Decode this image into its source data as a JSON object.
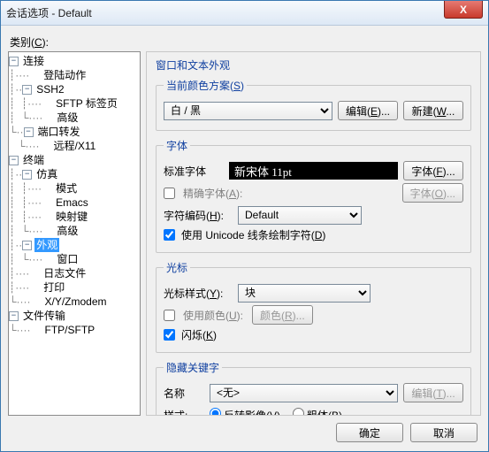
{
  "window": {
    "title": "会话选项 - Default",
    "close": "X"
  },
  "cat_label_pre": "类别(",
  "cat_label_u": "C",
  "cat_label_post": "):",
  "tree": {
    "n0": "连接",
    "n0_0": "登陆动作",
    "n0_1": "SSH2",
    "n0_1_0": "SFTP 标签页",
    "n0_1_1": "高级",
    "n0_2": "端口转发",
    "n0_2_0": "远程/X11",
    "n1": "终端",
    "n1_0": "仿真",
    "n1_0_0": "模式",
    "n1_0_1": "Emacs",
    "n1_0_2": "映射键",
    "n1_0_3": "高级",
    "n1_1": "外观",
    "n1_1_0": "窗口",
    "n1_2": "日志文件",
    "n1_3": "打印",
    "n1_4": "X/Y/Zmodem",
    "n2": "文件传输",
    "n2_0": "FTP/SFTP"
  },
  "pane_title": "窗口和文本外观",
  "scheme": {
    "legend_pre": "当前颜色方案(",
    "legend_u": "S",
    "legend_post": ")",
    "value": "白 / 黑",
    "edit_pre": "编辑(",
    "edit_u": "E",
    "edit_post": ")...",
    "new_pre": "新建(",
    "new_u": "W",
    "new_post": "..."
  },
  "fonts": {
    "legend": "字体",
    "std_label": "标准字体",
    "std_value": "新宋体  11pt",
    "std_btn_pre": "字体(",
    "std_btn_u": "F",
    "std_btn_post": ")...",
    "exact_pre": "精确字体(",
    "exact_u": "A",
    "exact_post": "):",
    "exact_btn_pre": "字体(",
    "exact_btn_u": "O",
    "exact_btn_post": ")...",
    "enc_pre": "字符编码(",
    "enc_u": "H",
    "enc_post": "):",
    "enc_value": "Default",
    "uni_pre": "使用 Unicode 线条绘制字符(",
    "uni_u": "D",
    "uni_post": ")"
  },
  "cursor": {
    "legend": "光标",
    "style_pre": "光标样式(",
    "style_u": "Y",
    "style_post": "):",
    "style_value": "块",
    "color_pre": "使用颜色(",
    "color_u": "U",
    "color_post": "):",
    "color_btn_pre": "颜色(",
    "color_btn_u": "R",
    "color_btn_post": ")...",
    "blink_pre": "闪烁(",
    "blink_u": "K",
    "blink_post": ")"
  },
  "hidden": {
    "legend": "隐藏关键字",
    "name_label": "名称",
    "name_value": "<无>",
    "edit_pre": "编辑(",
    "edit_u": "T",
    "edit_post": ")...",
    "style_label": "样式:",
    "rev_pre": "反转影像(",
    "rev_u": "V",
    "rev_post": ")",
    "bold_pre": "粗体(",
    "bold_u": "B",
    "bold_post": ")"
  },
  "buttons": {
    "ok": "确定",
    "cancel": "取消"
  }
}
